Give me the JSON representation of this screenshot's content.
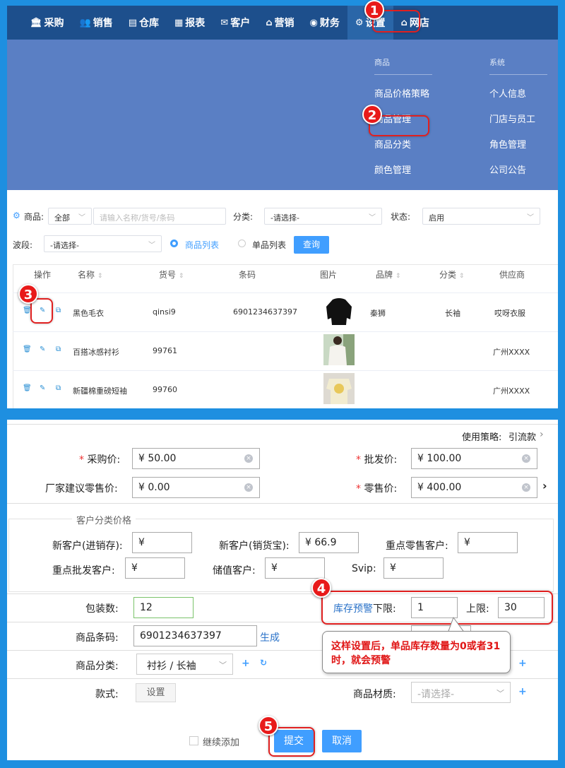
{
  "topnav": {
    "items": [
      {
        "label": "采购",
        "icon": "bank-icon"
      },
      {
        "label": "销售",
        "icon": "users-icon"
      },
      {
        "label": "仓库",
        "icon": "warehouse-icon"
      },
      {
        "label": "报表",
        "icon": "report-icon"
      },
      {
        "label": "客户",
        "icon": "mail-icon"
      },
      {
        "label": "营销",
        "icon": "tag-icon"
      },
      {
        "label": "财务",
        "icon": "coins-icon"
      },
      {
        "label": "设置",
        "icon": "settings-icon"
      },
      {
        "label": "网店",
        "icon": "home-icon"
      }
    ]
  },
  "megamenu": {
    "col1": {
      "head": "商品",
      "items": [
        "商品价格策略",
        "商品管理",
        "商品分类",
        "颜色管理"
      ]
    },
    "col2": {
      "head": "系统",
      "items": [
        "个人信息",
        "门店与员工",
        "角色管理",
        "公司公告"
      ]
    }
  },
  "filter": {
    "goods_label": "商品:",
    "goods_scope": "全部",
    "goods_placeholder": "请输入名称/货号/条码",
    "category_label": "分类:",
    "category_value": "-请选择-",
    "status_label": "状态:",
    "status_value": "启用",
    "wave_label": "波段:",
    "wave_value": "-请选择-",
    "radio_goods_list": "商品列表",
    "radio_sku_list": "单品列表",
    "query_button": "查询"
  },
  "table": {
    "headers": [
      "操作",
      "名称",
      "货号",
      "条码",
      "图片",
      "品牌",
      "分类",
      "供应商"
    ],
    "rows": [
      {
        "name": "黑色毛衣",
        "code": "qinsi9",
        "barcode": "6901234637397",
        "brand": "秦狮",
        "category": "长袖",
        "supplier": "哎呀衣服"
      },
      {
        "name": "百搭冰感衬衫",
        "code": "99761",
        "barcode": "",
        "brand": "",
        "category": "",
        "supplier": "广州XXXX"
      },
      {
        "name": "新疆棉重磅短袖",
        "code": "99760",
        "barcode": "",
        "brand": "",
        "category": "",
        "supplier": "广州XXXX"
      }
    ]
  },
  "form": {
    "strategy_label": "使用策略:",
    "strategy_value": "引流款",
    "purchase_price_label": "采购价:",
    "purchase_price": "¥ 50.00",
    "wholesale_price_label": "批发价:",
    "wholesale_price": "¥ 100.00",
    "suggested_retail_label": "厂家建议零售价:",
    "suggested_retail": "¥ 0.00",
    "retail_price_label": "零售价:",
    "retail_price": "¥ 400.00",
    "customer_price_legend": "客户分类价格",
    "new_customer_jxc_label": "新客户(进销存):",
    "new_customer_jxc": "¥",
    "new_customer_xhb_label": "新客户(销货宝):",
    "new_customer_xhb": "¥ 66.9",
    "key_retail_label": "重点零售客户:",
    "key_retail": "¥",
    "key_wholesale_label": "重点批发客户:",
    "key_wholesale": "¥",
    "stored_value_label": "储值客户:",
    "stored_value": "¥",
    "svip_label": "Svip:",
    "svip": "¥",
    "pack_qty_label": "包装数:",
    "pack_qty": "12",
    "stock_warning_link": "库存预警",
    "lower_limit_label": "下限:",
    "lower_limit": "1",
    "upper_limit_label": "上限:",
    "upper_limit": "30",
    "barcode_label": "商品条码:",
    "barcode": "6901234637397",
    "generate_link": "生成",
    "category_label": "商品分类:",
    "category": "衬衫 / 长袖",
    "style_label": "款式:",
    "style_button": "设置",
    "material_label": "商品材质:",
    "material_placeholder": "-请选择-",
    "continue_add": "继续添加",
    "submit": "提交",
    "cancel": "取消"
  },
  "annotations": {
    "badges": [
      "1",
      "2",
      "3",
      "4",
      "5"
    ],
    "callout": "这样设置后，单品库存数量为0或者31时，就会预警"
  }
}
